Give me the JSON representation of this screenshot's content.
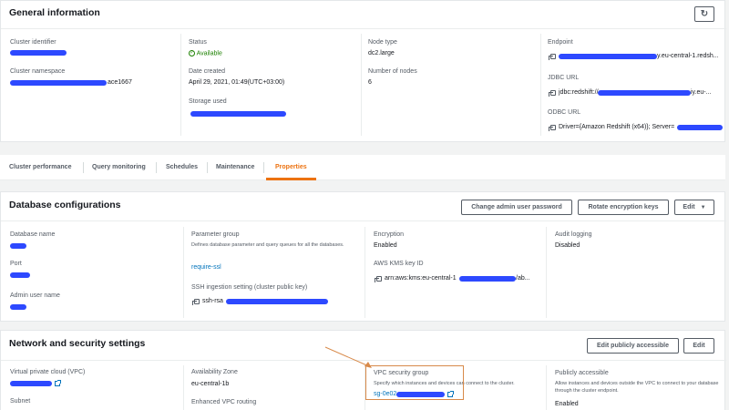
{
  "general": {
    "title": "General information",
    "cluster_identifier_label": "Cluster identifier",
    "cluster_namespace_label": "Cluster namespace",
    "cluster_namespace_suffix": "ace1667",
    "status_label": "Status",
    "status_value": "Available",
    "date_created_label": "Date created",
    "date_created_value": "April 29, 2021, 01:49(UTC+03:00)",
    "storage_used_label": "Storage used",
    "node_type_label": "Node type",
    "node_type_value": "dc2.large",
    "number_of_nodes_label": "Number of nodes",
    "number_of_nodes_value": "6",
    "endpoint_label": "Endpoint",
    "endpoint_suffix": "y.eu-central-1.redsh...",
    "jdbc_label": "JDBC URL",
    "jdbc_prefix": "jdbc:redshift://",
    "jdbc_suffix": "iy.eu-...",
    "odbc_label": "ODBC URL",
    "odbc_prefix": "Driver={Amazon Redshift (x64)}; Server="
  },
  "tabs": [
    "Cluster performance",
    "Query monitoring",
    "Schedules",
    "Maintenance",
    "Properties"
  ],
  "db_config": {
    "title": "Database configurations",
    "change_password_button": "Change admin user password",
    "rotate_keys_button": "Rotate encryption keys",
    "edit_button": "Edit",
    "database_name_label": "Database name",
    "port_label": "Port",
    "admin_user_label": "Admin user name",
    "parameter_group_label": "Parameter group",
    "parameter_group_desc": "Defines database parameter and query queues for all the databases.",
    "parameter_group_value": "require-ssl",
    "ssh_label": "SSH ingestion setting (cluster public key)",
    "ssh_value": "ssh-rsa",
    "encryption_label": "Encryption",
    "encryption_value": "Enabled",
    "kms_label": "AWS KMS key ID",
    "kms_prefix": "arn:aws:kms:eu-central-1",
    "kms_suffix": "/ab...",
    "audit_label": "Audit logging",
    "audit_value": "Disabled"
  },
  "network": {
    "title": "Network and security settings",
    "edit_public_button": "Edit publicly accessible",
    "edit_button": "Edit",
    "vpc_label": "Virtual private cloud (VPC)",
    "subnet_label": "Subnet",
    "az_label": "Availability Zone",
    "az_value": "eu-central-1b",
    "enhanced_vpc_label": "Enhanced VPC routing",
    "sg_label": "VPC security group",
    "sg_desc": "Specify which instances and devices can connect to the cluster.",
    "sg_prefix": "sg-0e02",
    "public_label": "Publicly accessible",
    "public_desc": "Allow instances and devices outside the VPC to connect to your database through the cluster endpoint.",
    "public_value": "Enabled"
  },
  "colors": {
    "accent": "#ec7211",
    "link": "#0073bb",
    "success": "#1d8102",
    "redaction": "#1b3aff"
  }
}
